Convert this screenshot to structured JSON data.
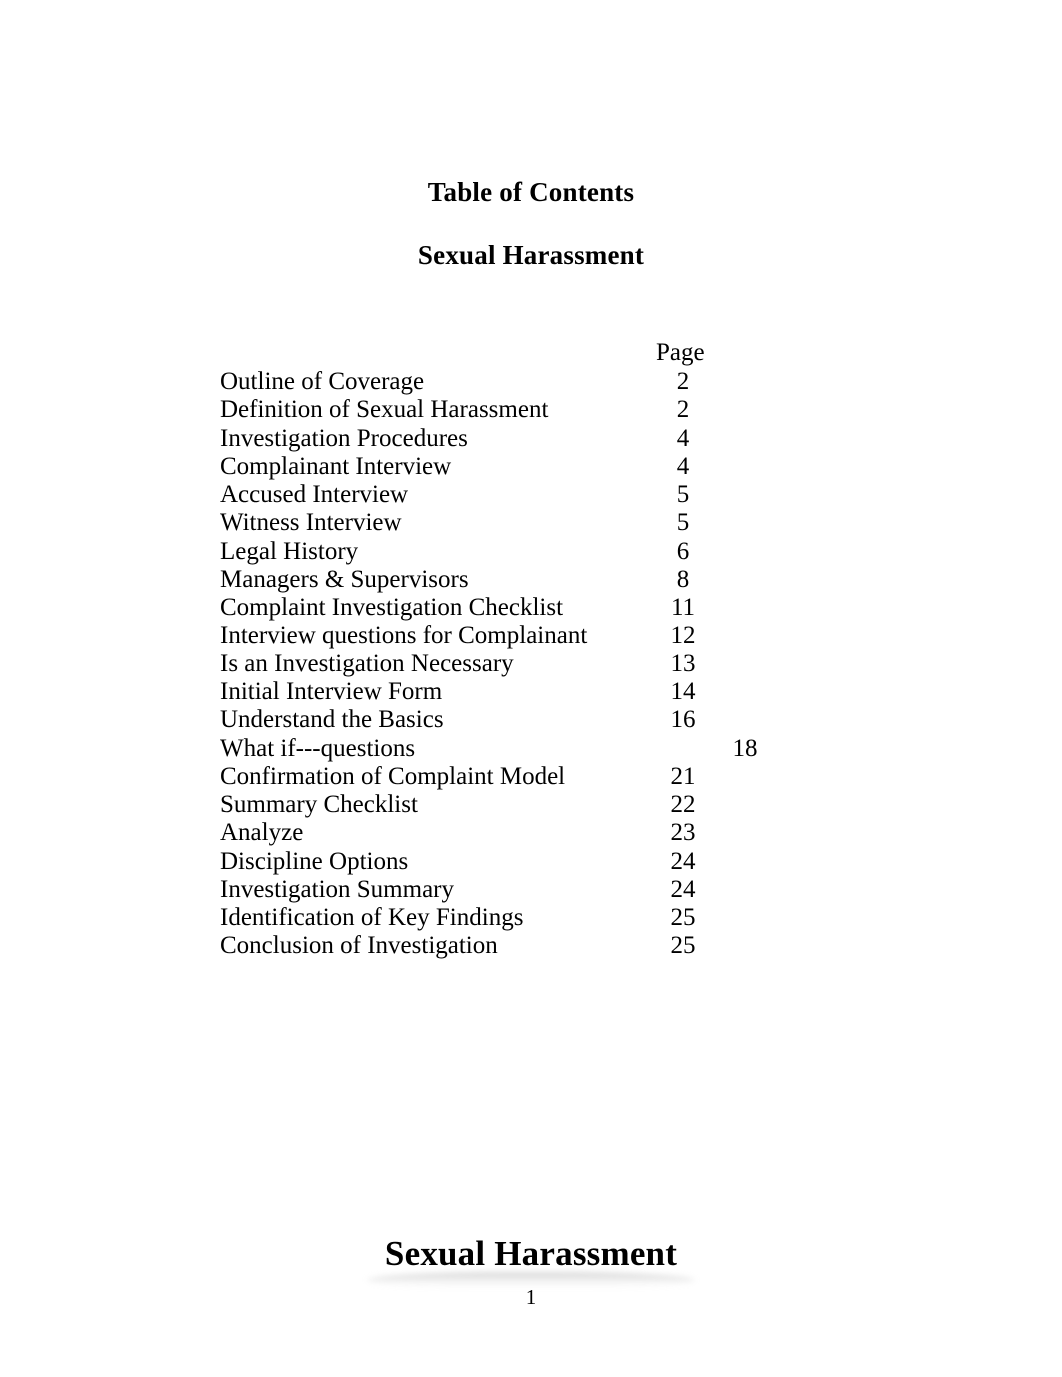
{
  "document": {
    "title": "Table of Contents",
    "subject": "Sexual Harassment",
    "bottom_heading": "Sexual Harassment",
    "folio": "1"
  },
  "toc": {
    "page_column_header": "Page",
    "entries": [
      {
        "label": "Outline of Coverage",
        "page": "2"
      },
      {
        "label": "Definition of Sexual Harassment",
        "page": "2"
      },
      {
        "label": "Investigation Procedures",
        "page": "4"
      },
      {
        "label": "Complainant Interview",
        "page": "4"
      },
      {
        "label": "Accused Interview",
        "page": "5"
      },
      {
        "label": "Witness Interview",
        "page": "5"
      },
      {
        "label": "Legal History",
        "page": "6"
      },
      {
        "label": "Managers & Supervisors",
        "page": "8"
      },
      {
        "label": "Complaint Investigation Checklist",
        "page": "11"
      },
      {
        "label": "Interview questions for Complainant",
        "page": "12"
      },
      {
        "label": "Is an Investigation Necessary",
        "page": "13"
      },
      {
        "label": "Initial Interview Form",
        "page": "14"
      },
      {
        "label": "Understand the Basics",
        "page": "16"
      },
      {
        "label": "What if---questions",
        "page": "18"
      },
      {
        "label": "Confirmation of Complaint Model",
        "page": "21"
      },
      {
        "label": "Summary Checklist",
        "page": "22"
      },
      {
        "label": "Analyze",
        "page": "23"
      },
      {
        "label": "Discipline Options",
        "page": "24"
      },
      {
        "label": "Investigation Summary",
        "page": "24"
      },
      {
        "label": "Identification of Key Findings",
        "page": "25"
      },
      {
        "label": "Conclusion of Investigation",
        "page": "25"
      }
    ]
  }
}
